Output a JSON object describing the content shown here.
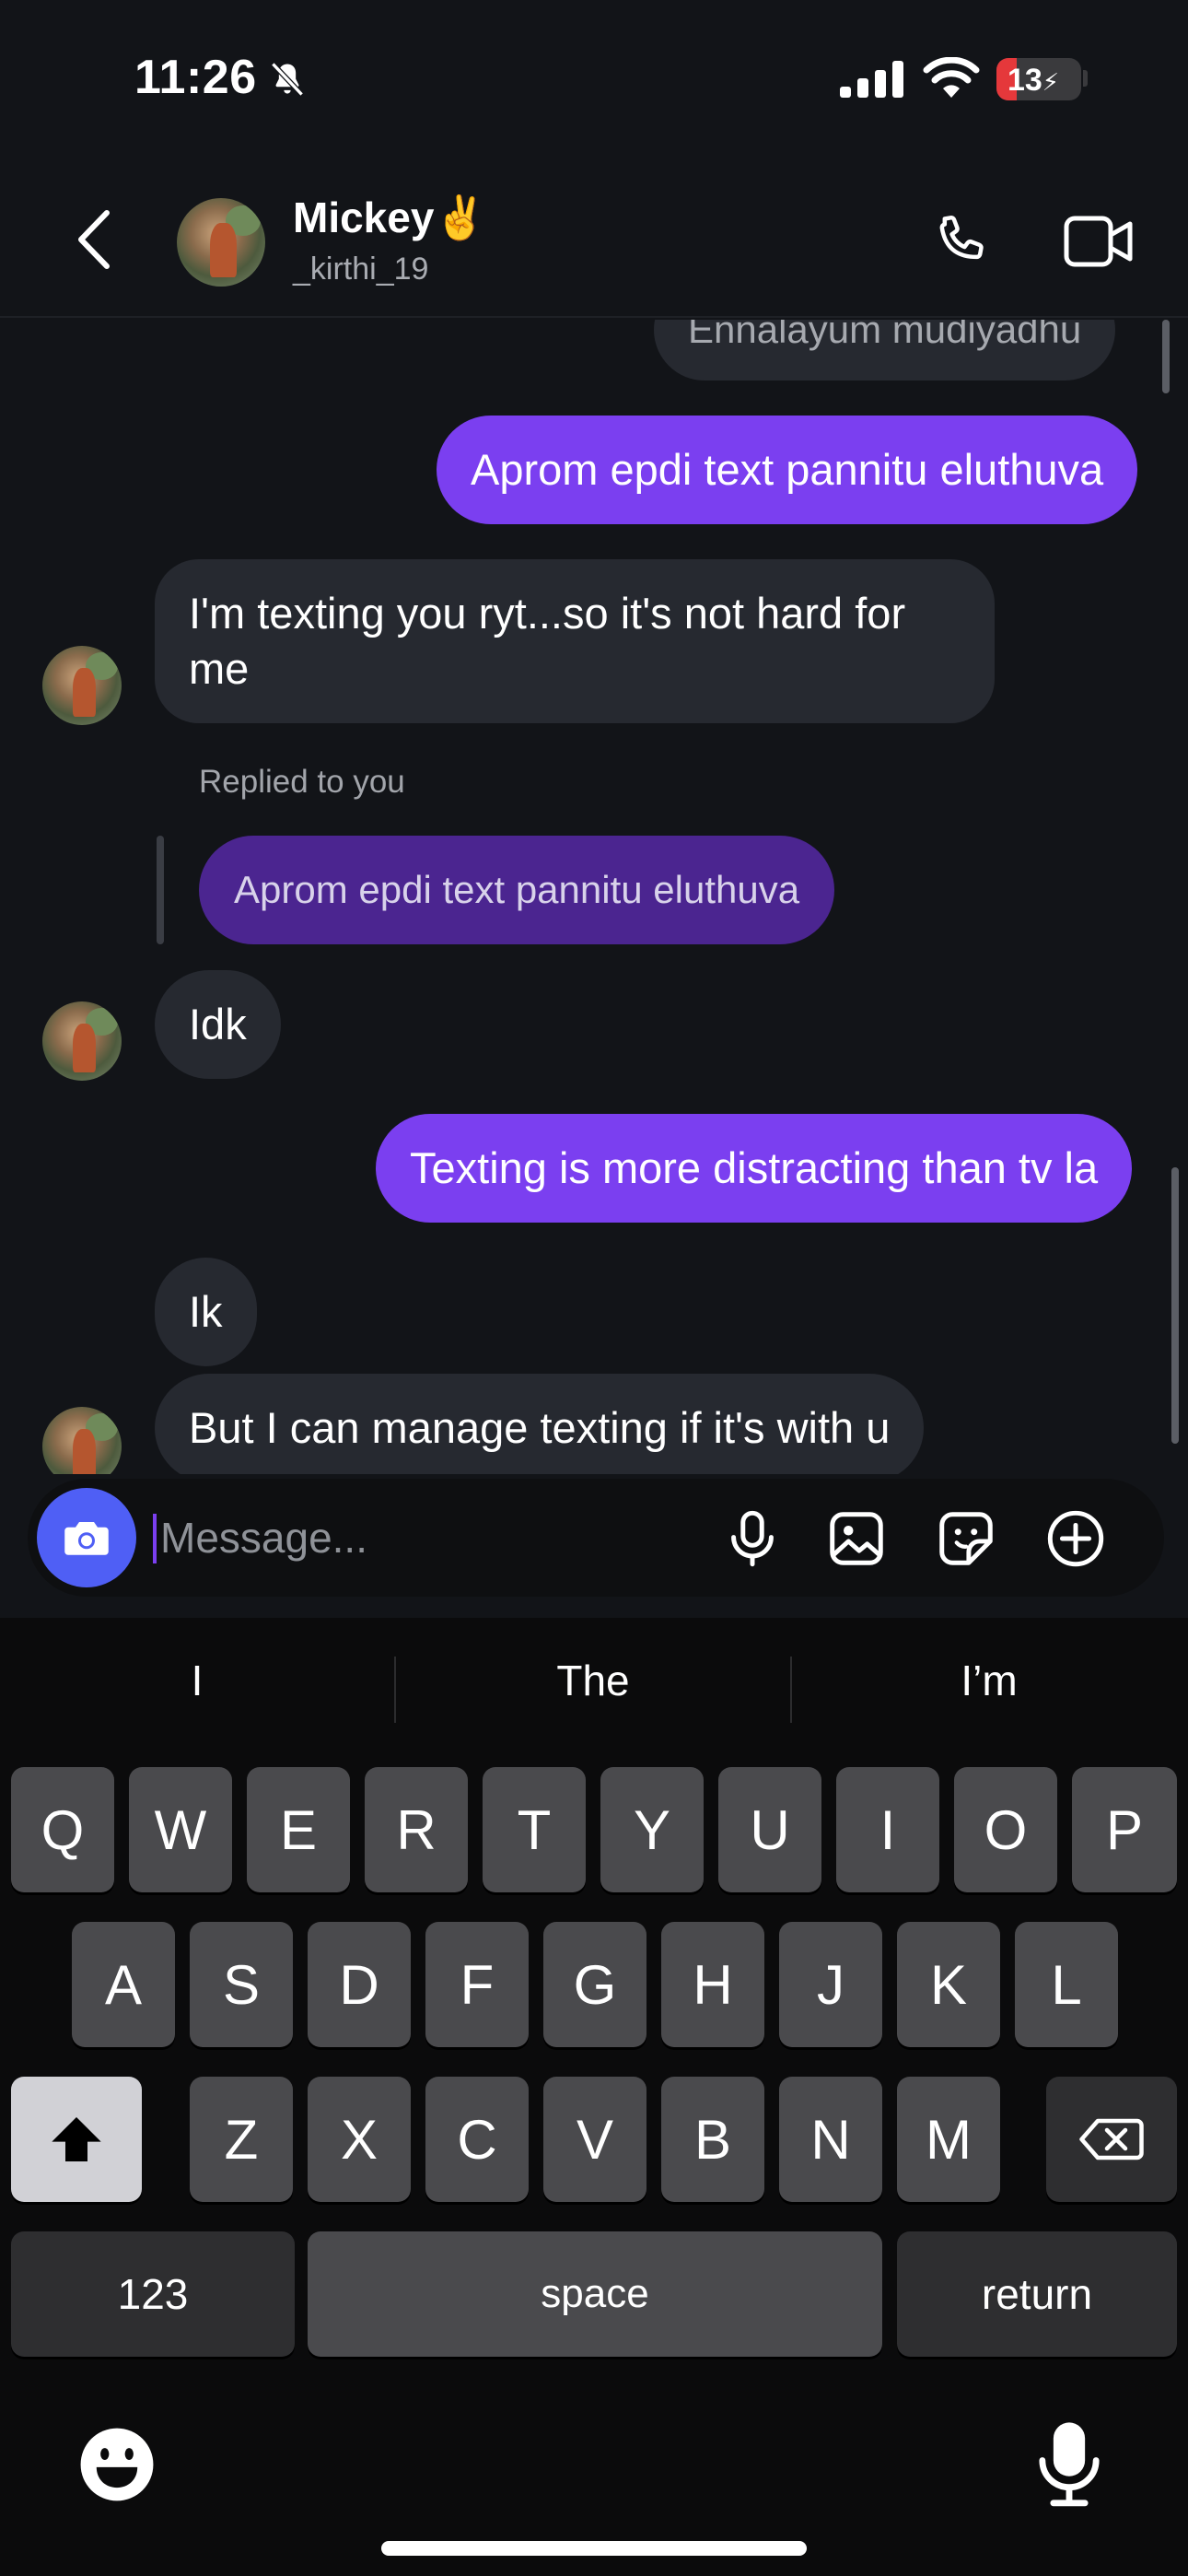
{
  "status_bar": {
    "time": "11:26",
    "battery": "13"
  },
  "header": {
    "name": "Mickey✌️",
    "username": "_kirthi_19"
  },
  "messages": [
    {
      "side": "in",
      "text": "Ennalayum mudiyadhu"
    },
    {
      "side": "out",
      "text": "Aprom epdi text pannitu eluthuva"
    },
    {
      "side": "in",
      "line1": "I'm texting you ryt...so it's not hard for",
      "line2": "me"
    },
    {
      "side": "reply",
      "label": "Replied to you",
      "quoted": "Aprom epdi text pannitu eluthuva"
    },
    {
      "side": "in",
      "text": "Idk"
    },
    {
      "side": "out",
      "text": "Texting is more distracting than tv la"
    },
    {
      "side": "in",
      "text": "Ik"
    },
    {
      "side": "in",
      "text": "But I can manage texting if it's with u"
    }
  ],
  "composer": {
    "placeholder": "Message...",
    "icons": [
      "camera-icon",
      "microphone-icon",
      "gallery-icon",
      "sticker-icon",
      "plus-circle-icon"
    ]
  },
  "keyboard": {
    "suggestions": [
      "I",
      "The",
      "I’m"
    ],
    "row1": [
      "Q",
      "W",
      "E",
      "R",
      "T",
      "Y",
      "U",
      "I",
      "O",
      "P"
    ],
    "row2": [
      "A",
      "S",
      "D",
      "F",
      "G",
      "H",
      "J",
      "K",
      "L"
    ],
    "row3": [
      "Z",
      "X",
      "C",
      "V",
      "B",
      "N",
      "M"
    ],
    "numbers": "123",
    "space": "space",
    "return": "return"
  },
  "colors": {
    "accent": "#7b3ff0",
    "camera": "#4f5ff5",
    "incoming": "#262930"
  }
}
